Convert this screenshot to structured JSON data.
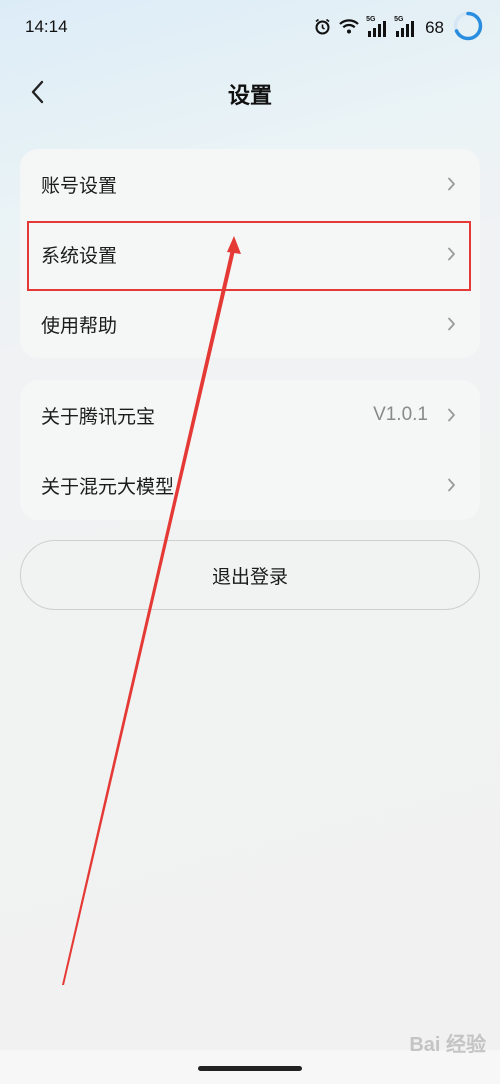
{
  "status_bar": {
    "time": "14:14",
    "signal_1_tag": "5G",
    "signal_2_tag": "5G",
    "battery": "68"
  },
  "header": {
    "title": "设置",
    "back_icon": "chevron-left-icon"
  },
  "settings_group": {
    "items": [
      {
        "label": "账号设置"
      },
      {
        "label": "系统设置"
      },
      {
        "label": "使用帮助"
      }
    ]
  },
  "about_group": {
    "items": [
      {
        "label": "关于腾讯元宝",
        "value": "V1.0.1"
      },
      {
        "label": "关于混元大模型"
      }
    ]
  },
  "logout_label": "退出登录",
  "annotation": {
    "highlight_color": "#e53935",
    "highlighted_item": "系统设置"
  },
  "watermark": "Bai 经验"
}
